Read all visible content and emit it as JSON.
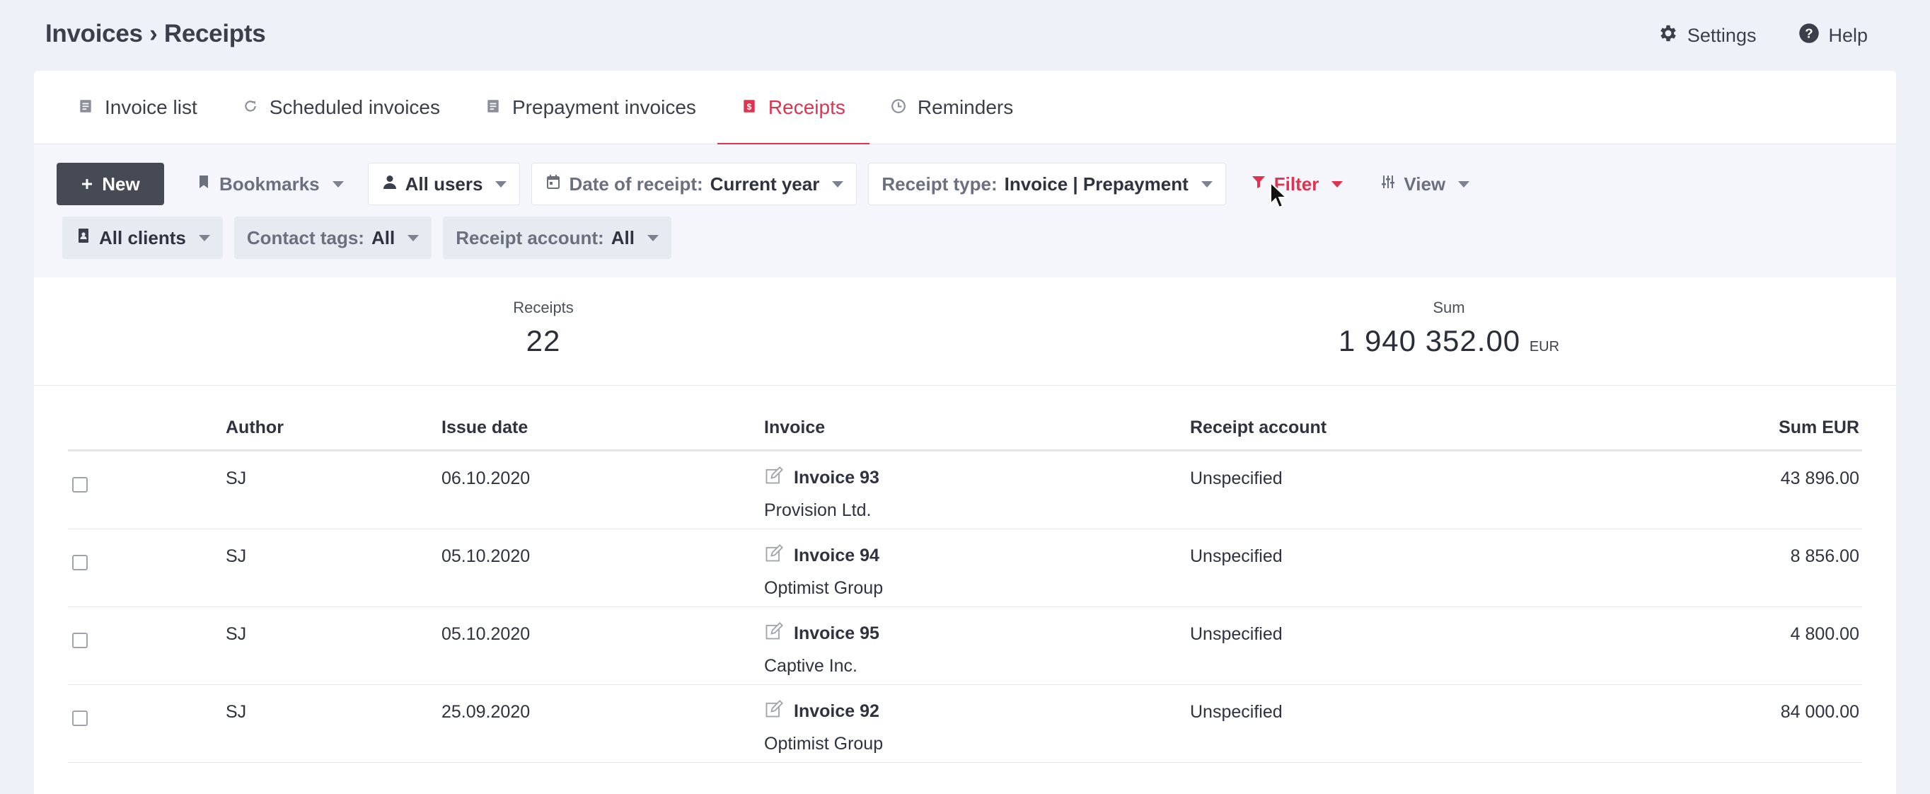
{
  "header": {
    "breadcrumb": "Invoices › Receipts",
    "settings_label": "Settings",
    "help_label": "Help"
  },
  "tabs": [
    {
      "label": "Invoice list",
      "icon": "document-icon"
    },
    {
      "label": "Scheduled invoices",
      "icon": "refresh-icon"
    },
    {
      "label": "Prepayment invoices",
      "icon": "document-icon"
    },
    {
      "label": "Receipts",
      "icon": "receipt-icon",
      "active": true
    },
    {
      "label": "Reminders",
      "icon": "clock-icon"
    }
  ],
  "toolbar": {
    "new_label": "New",
    "bookmarks_label": "Bookmarks",
    "users_label": "All users",
    "date_filter": {
      "label": "Date of receipt:",
      "value": "Current year"
    },
    "receipt_type": {
      "label": "Receipt type:",
      "value": "Invoice | Prepayment"
    },
    "filter_label": "Filter",
    "view_label": "View",
    "clients_label": "All clients",
    "contact_tags": {
      "label": "Contact tags:",
      "value": "All"
    },
    "receipt_account": {
      "label": "Receipt account:",
      "value": "All"
    }
  },
  "summary": {
    "receipts_label": "Receipts",
    "receipts_value": "22",
    "sum_label": "Sum",
    "sum_value": "1 940 352.00",
    "sum_unit": "EUR"
  },
  "table": {
    "columns": {
      "author": "Author",
      "issue_date": "Issue date",
      "invoice": "Invoice",
      "receipt_account": "Receipt account",
      "sum": "Sum EUR"
    },
    "rows": [
      {
        "author": "SJ",
        "issue_date": "06.10.2020",
        "invoice": "Invoice 93",
        "client": "Provision Ltd.",
        "account": "Unspecified",
        "sum": "43 896.00"
      },
      {
        "author": "SJ",
        "issue_date": "05.10.2020",
        "invoice": "Invoice 94",
        "client": "Optimist Group",
        "account": "Unspecified",
        "sum": "8 856.00"
      },
      {
        "author": "SJ",
        "issue_date": "05.10.2020",
        "invoice": "Invoice 95",
        "client": "Captive Inc.",
        "account": "Unspecified",
        "sum": "4 800.00"
      },
      {
        "author": "SJ",
        "issue_date": "25.09.2020",
        "invoice": "Invoice 92",
        "client": "Optimist Group",
        "account": "Unspecified",
        "sum": "84 000.00"
      }
    ]
  },
  "colors": {
    "accent": "#e0334f",
    "new_button": "#454a55",
    "background": "#eef2f8"
  }
}
